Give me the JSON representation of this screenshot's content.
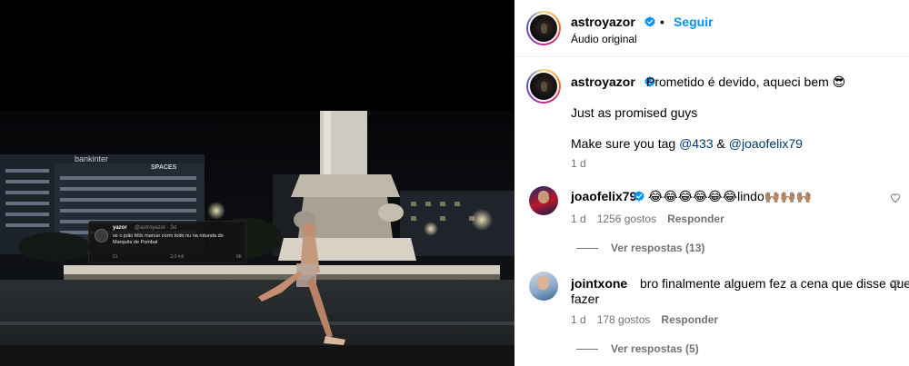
{
  "post": {
    "author": "astroyazor",
    "follow_label": "Seguir",
    "audio_label": "Áudio original",
    "caption_line1": "Prometido é devido, aqueci bem 😎",
    "caption_line2": "Just as promised guys",
    "caption_line3_prefix": "Make sure you tag ",
    "caption_tag1": "@433",
    "caption_amp": " & ",
    "caption_tag2": "@joaofelix79",
    "caption_time": "1 d"
  },
  "video_overlay": {
    "tweet_name": "yazor",
    "tweet_handle": "@astroyazor · 3d",
    "tweet_text": "se o joão félix marcar corro todo nu na rotunda do Marquês de Pombal",
    "tweet_counts": [
      "51",
      "2,0 mil",
      "9K"
    ],
    "building_sign1": "bankinter",
    "building_sign2": "SPACES"
  },
  "comments": [
    {
      "user": "joaofelix79",
      "text": "😂😂😂😂😂😂lindo🙌🏽🙌🏽🙌🏽",
      "time": "1 d",
      "likes": "1256 gostos",
      "reply_label": "Responder",
      "view_replies": "Ver respostas (13)"
    },
    {
      "user": "jointxone",
      "text_line1": "bro finalmente alguem fez a cena que disse que ia",
      "text_line2": "fazer",
      "time": "1 d",
      "likes": "178 gostos",
      "reply_label": "Responder",
      "view_replies": "Ver respostas (5)"
    }
  ],
  "colors": {
    "follow_blue": "#0095f6",
    "link_blue": "#00376b",
    "verified_blue": "#0095f6",
    "meta_gray": "#737373"
  },
  "icons": [
    "verified-badge-icon",
    "heart-icon"
  ]
}
